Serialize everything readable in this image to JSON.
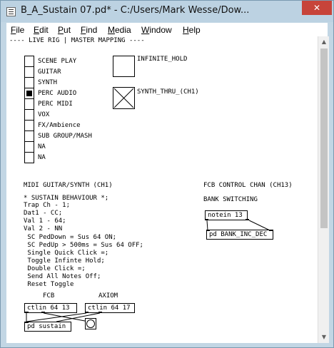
{
  "window": {
    "title": "B_A_Sustain 07.pd* - C:/Users/Mark Wesse/Dow...",
    "close_glyph": "✕"
  },
  "menu": [
    "File",
    "Edit",
    "Put",
    "Find",
    "Media",
    "Window",
    "Help"
  ],
  "canvas": {
    "header": "---- LIVE RIG | MASTER MAPPING ----",
    "radio_labels": [
      "SCENE PLAY",
      "GUITAR",
      "SYNTH",
      "PERC AUDIO",
      "PERC MIDI",
      "VOX",
      "FX/Ambience",
      "SUB GROUP/MASH",
      "NA",
      "NA"
    ],
    "radio_selected_index": 3,
    "infinite_hold_label": "INFINITE_HOLD",
    "synth_thru_label": "SYNTH_THRU_(CH1)",
    "midi_heading": "MIDI GUITAR/SYNTH (CH1)",
    "sustain_notes": [
      "* SUSTAIN BEHAVIOUR *;",
      "Trap Ch - 1;",
      "Dat1 - CC;",
      "Val 1 - 64;",
      "Val 2 - NN",
      " SC PedDown = Sus 64 ON;",
      " SC PedUp > 500ms = Sus 64 OFF;",
      " Single Quick Click =;",
      " Toggle Infinte Hold;",
      " Double Click =;",
      " Send All Notes Off;",
      " Reset Toggle"
    ],
    "fcb_chan_heading": "FCB CONTROL CHAN (CH13)",
    "bank_switching": "BANK SWITCHING",
    "fcb_label": "FCB",
    "axiom_label": "AXIOM",
    "objects": {
      "notein": "notein 13",
      "bank_inc_dec": "pd BANK_INC_DEC",
      "ctlin_fcb": "ctlin 64 13",
      "ctlin_axiom": "ctlin 64 17",
      "pd_sustain": "pd sustain"
    }
  }
}
